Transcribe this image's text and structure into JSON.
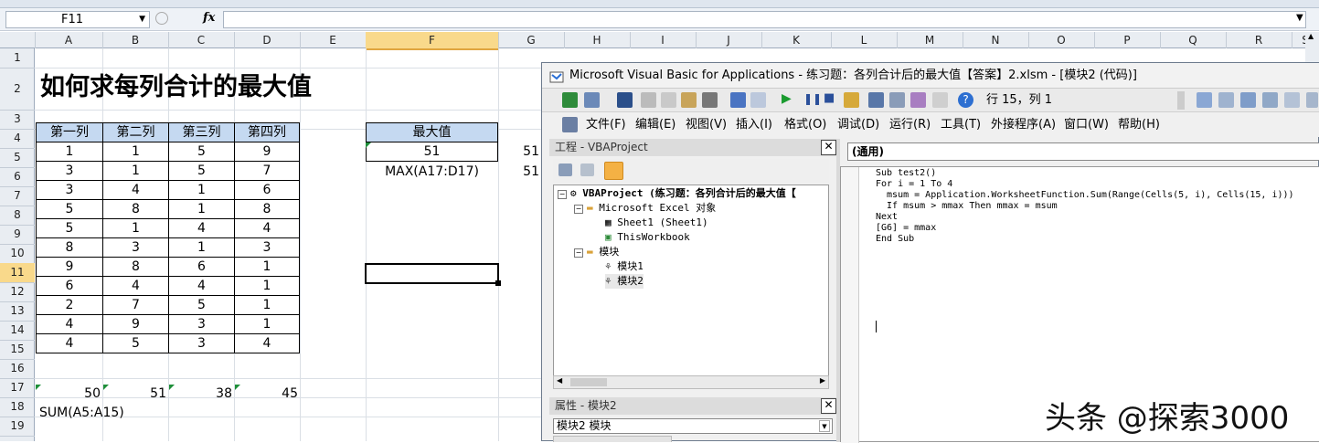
{
  "excel": {
    "name_box": "F11",
    "fx_label": "fx",
    "columns": [
      "A",
      "B",
      "C",
      "D",
      "E",
      "F",
      "G",
      "H",
      "I",
      "J",
      "K",
      "L",
      "M",
      "N",
      "O",
      "P",
      "Q",
      "R",
      "S"
    ],
    "rows": [
      "1",
      "2",
      "3",
      "4",
      "5",
      "6",
      "7",
      "8",
      "9",
      "10",
      "11",
      "12",
      "13",
      "14",
      "15",
      "16",
      "17",
      "18",
      "19"
    ],
    "title": "如何求每列合计的最大值",
    "table_headers": [
      "第一列",
      "第二列",
      "第三列",
      "第四列"
    ],
    "table_rows": [
      [
        "1",
        "1",
        "5",
        "9"
      ],
      [
        "3",
        "1",
        "5",
        "7"
      ],
      [
        "3",
        "4",
        "1",
        "6"
      ],
      [
        "5",
        "8",
        "1",
        "8"
      ],
      [
        "5",
        "1",
        "4",
        "4"
      ],
      [
        "8",
        "3",
        "1",
        "3"
      ],
      [
        "9",
        "8",
        "6",
        "1"
      ],
      [
        "6",
        "4",
        "4",
        "1"
      ],
      [
        "2",
        "7",
        "5",
        "1"
      ],
      [
        "4",
        "9",
        "3",
        "1"
      ],
      [
        "4",
        "5",
        "3",
        "4"
      ]
    ],
    "max_header": "最大值",
    "max_value": "51",
    "max_formula": "MAX(A17:D17)",
    "g5": "51",
    "g6": "51",
    "sums": [
      "50",
      "51",
      "38",
      "45"
    ],
    "sum_formula": "SUM(A5:A15)"
  },
  "vba": {
    "title": "Microsoft Visual Basic for Applications - 练习题：各列合计后的最大值【答案】2.xlsm - [模块2 (代码)]",
    "position": "行 15，列 1",
    "menu": [
      "文件(F)",
      "编辑(E)",
      "视图(V)",
      "插入(I)",
      "格式(O)",
      "调试(D)",
      "运行(R)",
      "工具(T)",
      "外接程序(A)",
      "窗口(W)",
      "帮助(H)"
    ],
    "project_title": "工程 - VBAProject",
    "tree": [
      "VBAProject (练习题：各列合计后的最大值【",
      "Microsoft Excel 对象",
      "Sheet1 (Sheet1)",
      "ThisWorkbook",
      "模块",
      "模块1",
      "模块2"
    ],
    "properties_title": "属性 - 模块2",
    "properties_object": "模块2  模块",
    "object_combo": "(通用)",
    "code": [
      "Sub test2()",
      "For i = 1 To 4",
      "  msum = Application.WorksheetFunction.Sum(Range(Cells(5, i), Cells(15, i)))",
      "  If msum > mmax Then mmax = msum",
      "Next",
      "[G6] = mmax",
      "End Sub"
    ]
  },
  "watermark": "头条 @探索3000"
}
